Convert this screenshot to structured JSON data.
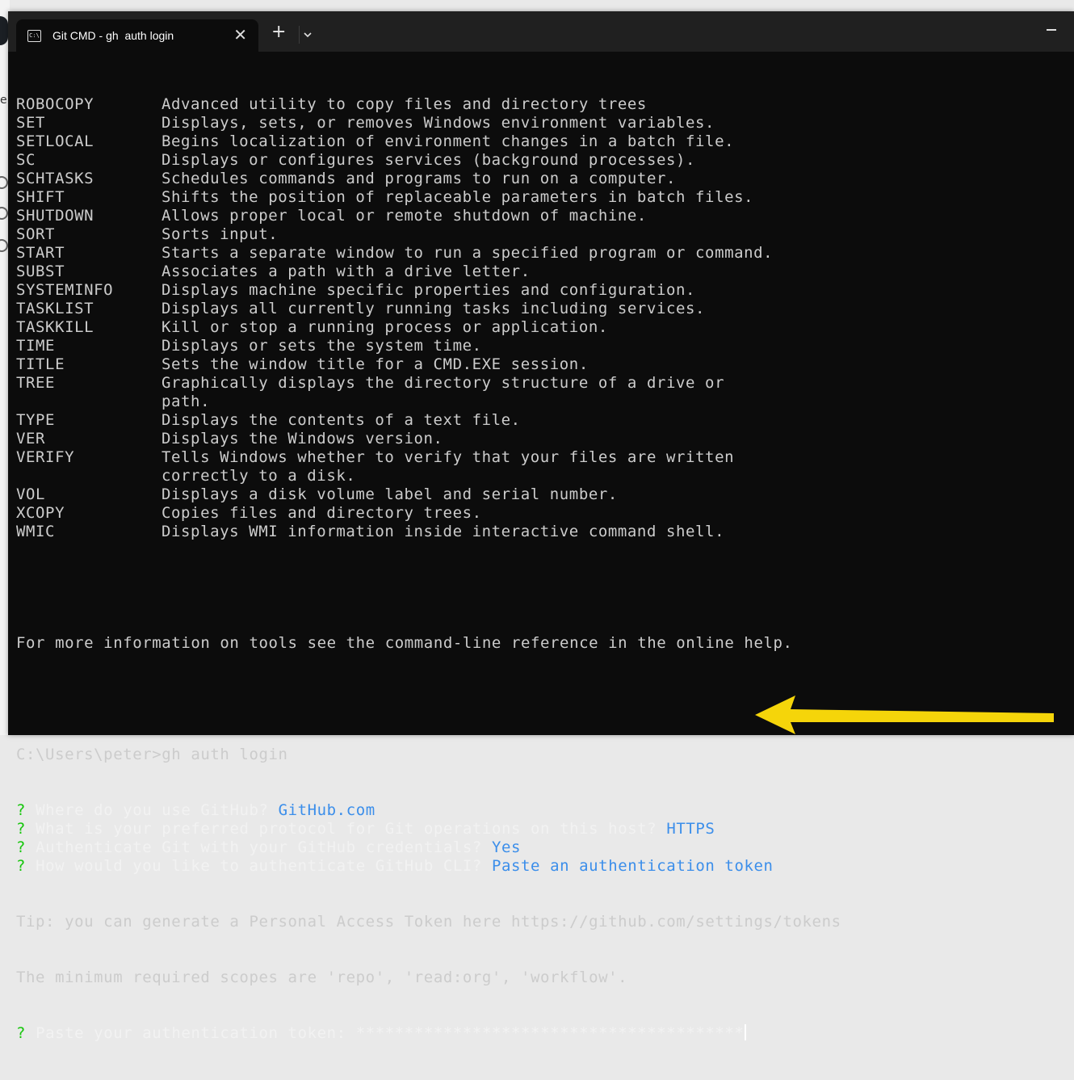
{
  "window": {
    "tab_title": "Git CMD - gh  auth login",
    "tab_icon": "C:\\",
    "tab_close": "✕",
    "new_tab": "+"
  },
  "colors": {
    "terminal_bg": "#0c0c0c",
    "text": "#cccccc",
    "prompt_question": "#16c60c",
    "answer": "#3b8eea",
    "arrow": "#f5d50a"
  },
  "commands": [
    {
      "name": "ROBOCOPY",
      "desc": "Advanced utility to copy files and directory trees"
    },
    {
      "name": "SET",
      "desc": "Displays, sets, or removes Windows environment variables."
    },
    {
      "name": "SETLOCAL",
      "desc": "Begins localization of environment changes in a batch file."
    },
    {
      "name": "SC",
      "desc": "Displays or configures services (background processes)."
    },
    {
      "name": "SCHTASKS",
      "desc": "Schedules commands and programs to run on a computer."
    },
    {
      "name": "SHIFT",
      "desc": "Shifts the position of replaceable parameters in batch files."
    },
    {
      "name": "SHUTDOWN",
      "desc": "Allows proper local or remote shutdown of machine."
    },
    {
      "name": "SORT",
      "desc": "Sorts input."
    },
    {
      "name": "START",
      "desc": "Starts a separate window to run a specified program or command."
    },
    {
      "name": "SUBST",
      "desc": "Associates a path with a drive letter."
    },
    {
      "name": "SYSTEMINFO",
      "desc": "Displays machine specific properties and configuration."
    },
    {
      "name": "TASKLIST",
      "desc": "Displays all currently running tasks including services."
    },
    {
      "name": "TASKKILL",
      "desc": "Kill or stop a running process or application."
    },
    {
      "name": "TIME",
      "desc": "Displays or sets the system time."
    },
    {
      "name": "TITLE",
      "desc": "Sets the window title for a CMD.EXE session."
    },
    {
      "name": "TREE",
      "desc": "Graphically displays the directory structure of a drive or"
    },
    {
      "name": "",
      "desc": "path."
    },
    {
      "name": "TYPE",
      "desc": "Displays the contents of a text file."
    },
    {
      "name": "VER",
      "desc": "Displays the Windows version."
    },
    {
      "name": "VERIFY",
      "desc": "Tells Windows whether to verify that your files are written"
    },
    {
      "name": "",
      "desc": "correctly to a disk."
    },
    {
      "name": "VOL",
      "desc": "Displays a disk volume label and serial number."
    },
    {
      "name": "XCOPY",
      "desc": "Copies files and directory trees."
    },
    {
      "name": "WMIC",
      "desc": "Displays WMI information inside interactive command shell."
    }
  ],
  "more_info": "For more information on tools see the command-line reference in the online help.",
  "prompt": "C:\\Users\\peter>gh auth login",
  "qa": [
    {
      "mark": "?",
      "question": "Where do you use GitHub?",
      "answer": "GitHub.com"
    },
    {
      "mark": "?",
      "question": "What is your preferred protocol for Git operations on this host?",
      "answer": "HTTPS"
    },
    {
      "mark": "?",
      "question": "Authenticate Git with your GitHub credentials?",
      "answer": "Yes"
    },
    {
      "mark": "?",
      "question": "How would you like to authenticate GitHub CLI?",
      "answer": "Paste an authentication token"
    }
  ],
  "tip": "Tip: you can generate a Personal Access Token here https://github.com/settings/tokens",
  "scopes": "The minimum required scopes are 'repo', 'read:org', 'workflow'.",
  "token_prompt": {
    "mark": "?",
    "label": "Paste your authentication token:",
    "value": "****************************************"
  }
}
